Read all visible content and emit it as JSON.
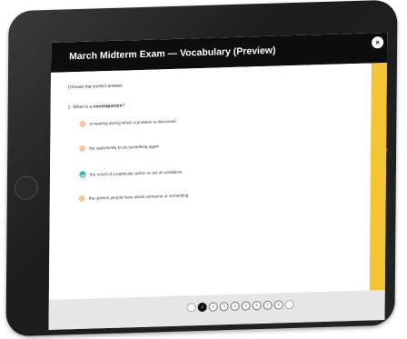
{
  "exam": {
    "title": "March Midterm Exam — Vocabulary (Preview)",
    "close_icon": "×"
  },
  "quiz": {
    "instruction": "Choose the correct answer.",
    "question_prefix": "1. What is a ",
    "question_term": "consequence",
    "question_suffix": "?",
    "options": [
      {
        "label": "a meeting during which a problem is discussed",
        "selected": false
      },
      {
        "label": "the opportunity to do something again",
        "selected": false
      },
      {
        "label": "the result of a particular action or set of conditions",
        "selected": true
      },
      {
        "label": "the opinion people have about someone or something",
        "selected": false
      }
    ]
  },
  "pagination": {
    "prev": "‹",
    "pages": [
      "1",
      "2",
      "3",
      "4",
      "5",
      "6",
      "7",
      "8"
    ],
    "current": "1",
    "next": "›"
  },
  "colors": {
    "accent_yellow": "#f3c433",
    "radio_unselected": "#f2c79a",
    "radio_selected": "#2ea7a6",
    "titlebar": "#0d0d0d"
  }
}
